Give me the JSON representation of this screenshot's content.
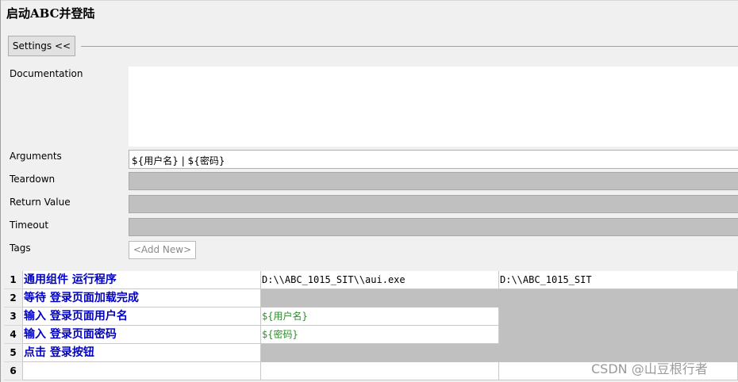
{
  "title": "启动ABC并登陆",
  "settings_button": "Settings <<",
  "fields": {
    "documentation_label": "Documentation",
    "arguments_label": "Arguments",
    "arguments_value": "${用户名} | ${密码}",
    "teardown_label": "Teardown",
    "return_value_label": "Return Value",
    "timeout_label": "Timeout",
    "tags_label": "Tags",
    "add_new": "<Add New>"
  },
  "rows": [
    {
      "num": "1",
      "keyword": "通用组件 运行程序",
      "arg1": "D:\\\\ABC_1015_SIT\\\\aui.exe",
      "arg2": "D:\\\\ABC_1015_SIT"
    },
    {
      "num": "2",
      "keyword": "等待 登录页面加载完成",
      "arg1": "",
      "arg2": ""
    },
    {
      "num": "3",
      "keyword": "输入 登录页面用户名",
      "arg1": "${用户名}",
      "arg2": ""
    },
    {
      "num": "4",
      "keyword": "输入 登录页面密码",
      "arg1": "${密码}",
      "arg2": ""
    },
    {
      "num": "5",
      "keyword": "点击 登录按钮",
      "arg1": "",
      "arg2": ""
    },
    {
      "num": "6",
      "keyword": "",
      "arg1": "",
      "arg2": ""
    }
  ],
  "watermark": "CSDN @山豆根行者"
}
